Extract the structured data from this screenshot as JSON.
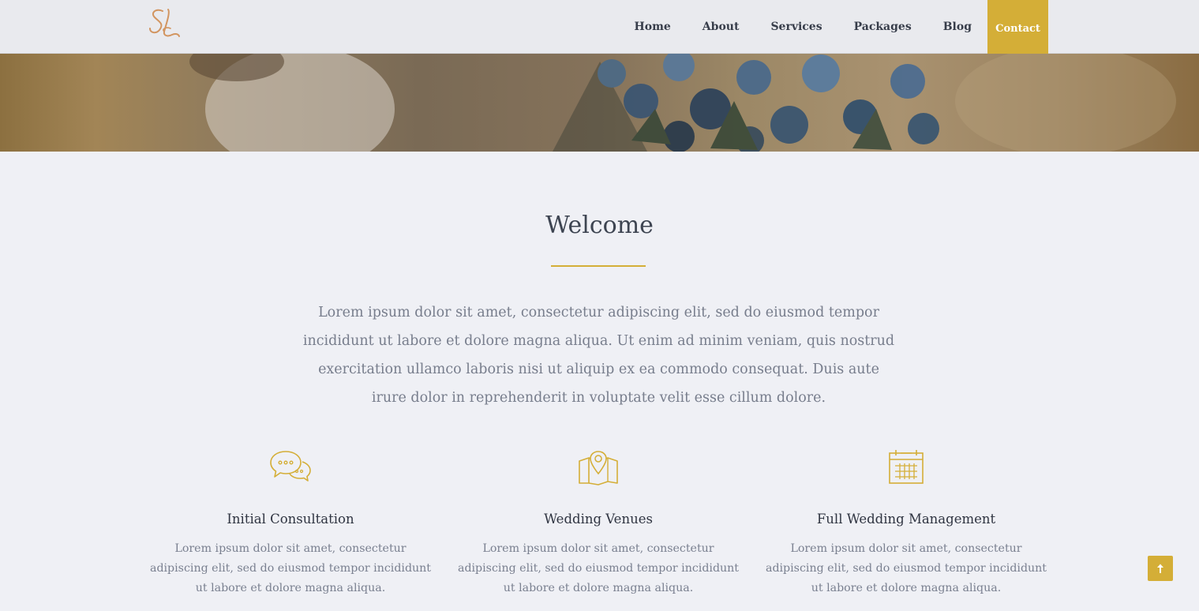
{
  "header": {
    "logo_text": "SL",
    "nav": [
      {
        "label": "Home"
      },
      {
        "label": "About"
      },
      {
        "label": "Services"
      },
      {
        "label": "Packages"
      },
      {
        "label": "Blog"
      },
      {
        "label": "Contact"
      }
    ]
  },
  "welcome": {
    "title": "Welcome",
    "text": "Lorem ipsum dolor sit amet, consectetur adipiscing elit, sed do eiusmod tempor incididunt ut labore et dolore magna aliqua. Ut enim ad minim veniam, quis nostrud exercitation ullamco laboris nisi ut aliquip ex ea commodo consequat. Duis aute irure dolor in reprehenderit in voluptate velit esse cillum dolore."
  },
  "features": [
    {
      "icon": "chat-bubbles-icon",
      "title": "Initial Consultation",
      "text": "Lorem ipsum dolor sit amet, consectetur adipiscing elit, sed do eiusmod tempor incididunt ut labore et dolore magna aliqua."
    },
    {
      "icon": "map-pin-icon",
      "title": "Wedding Venues",
      "text": "Lorem ipsum dolor sit amet, consectetur adipiscing elit, sed do eiusmod tempor incididunt ut labore et dolore magna aliqua."
    },
    {
      "icon": "calendar-icon",
      "title": "Full Wedding Management",
      "text": "Lorem ipsum dolor sit amet, consectetur adipiscing elit, sed do eiusmod tempor incididunt ut labore et dolore magna aliqua."
    }
  ],
  "colors": {
    "accent": "#d4ae37",
    "logo": "#d29560",
    "background": "#eff0f5",
    "header_bg": "#e9eaee",
    "heading": "#3d4451",
    "body_text": "#777d8c"
  },
  "back_to_top": {
    "icon": "arrow-up-icon"
  }
}
